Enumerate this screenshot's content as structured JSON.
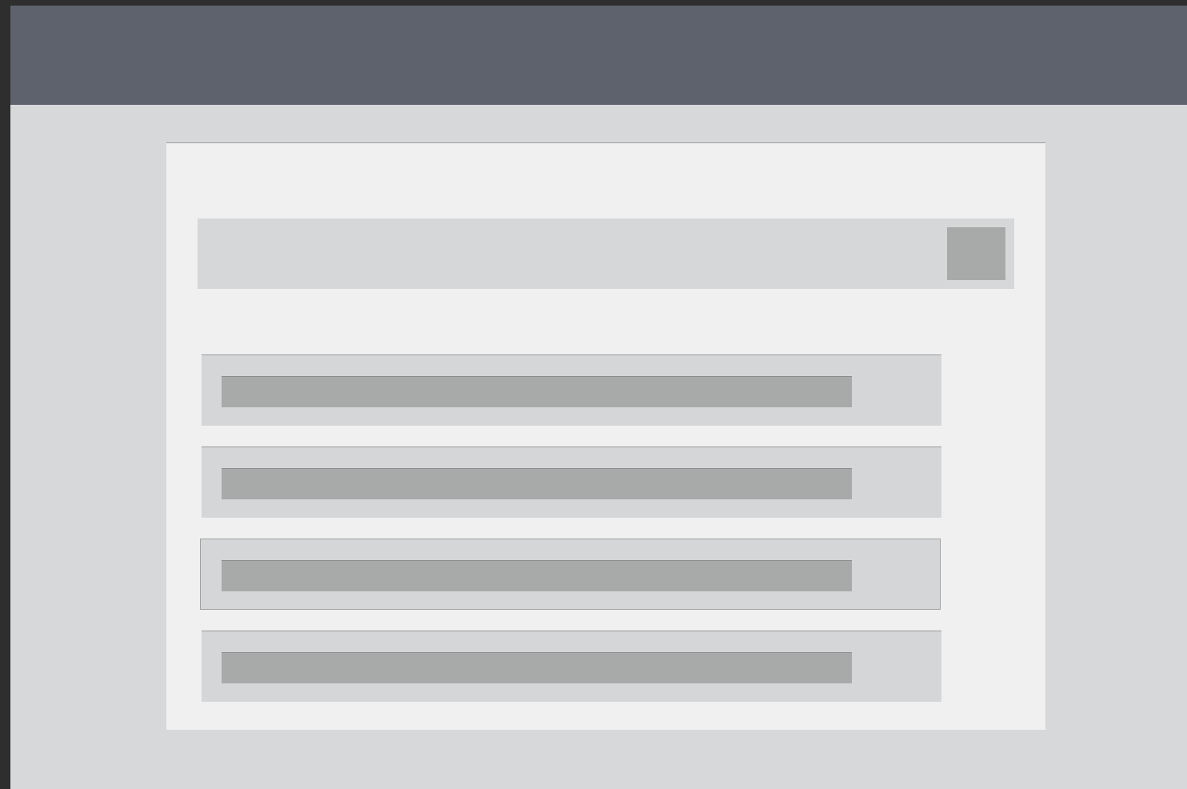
{
  "search": {
    "value": "",
    "placeholder": ""
  },
  "results": [
    {
      "label": ""
    },
    {
      "label": ""
    },
    {
      "label": ""
    },
    {
      "label": ""
    }
  ],
  "colors": {
    "header": "#5d626c",
    "page_background": "#d7d8da",
    "card": "#f0f0f0",
    "field": "#d6d7d9",
    "placeholder_block": "#a8aaa9",
    "frame": "#2e2e2f"
  }
}
